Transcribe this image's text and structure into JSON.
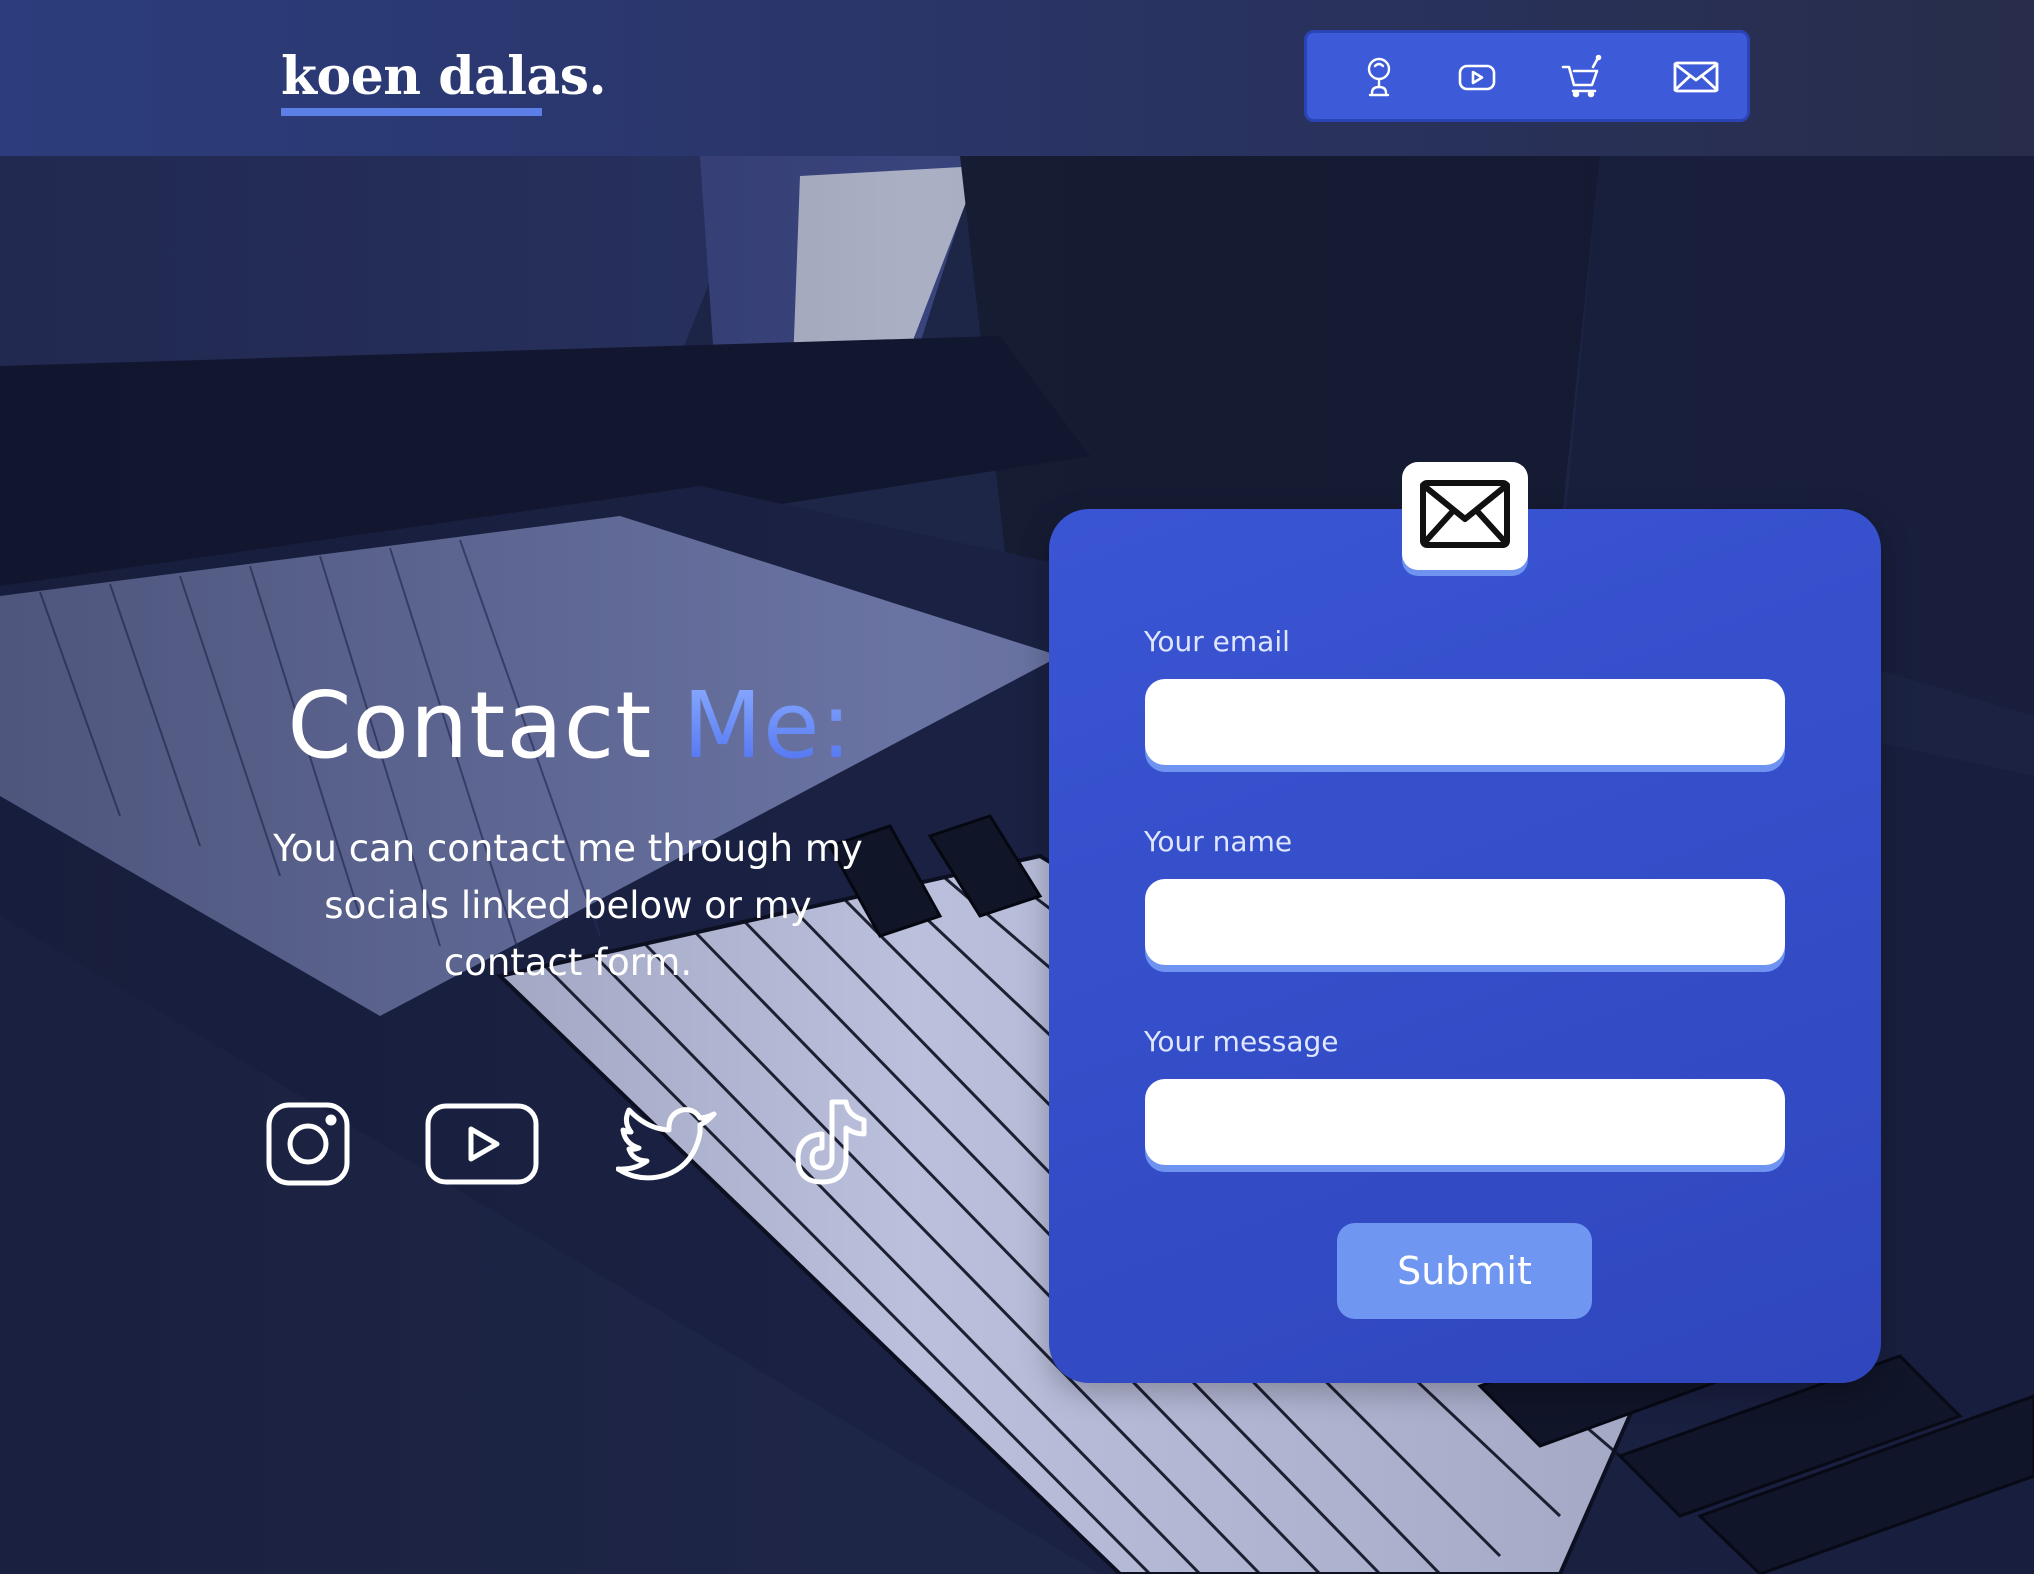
{
  "header": {
    "logo_text": "koen dalas.",
    "nav": [
      {
        "name": "about-icon",
        "label": ""
      },
      {
        "name": "youtube-icon",
        "label": ""
      },
      {
        "name": "cart-icon",
        "label": ""
      },
      {
        "name": "mail-icon",
        "label": ""
      }
    ]
  },
  "hero": {
    "title_main": "Contact ",
    "title_accent": "Me:",
    "description": "You can contact me through my socials linked below or my contact form.",
    "socials": [
      "instagram-icon",
      "youtube-icon",
      "twitter-icon",
      "tiktok-icon"
    ]
  },
  "form": {
    "header_icon": "envelope-icon",
    "email_label": "Your email",
    "email_value": "",
    "name_label": "Your name",
    "name_value": "",
    "message_label": "Your message",
    "message_value": "",
    "submit_label": "Submit"
  },
  "colors": {
    "header_bg": "#2c3c7c",
    "nav_bg": "#3d5ad8",
    "card_bg": "#3a55d4",
    "accent": "#6f93f0",
    "submit_bg": "#6f97f2",
    "text": "#ffffff"
  }
}
